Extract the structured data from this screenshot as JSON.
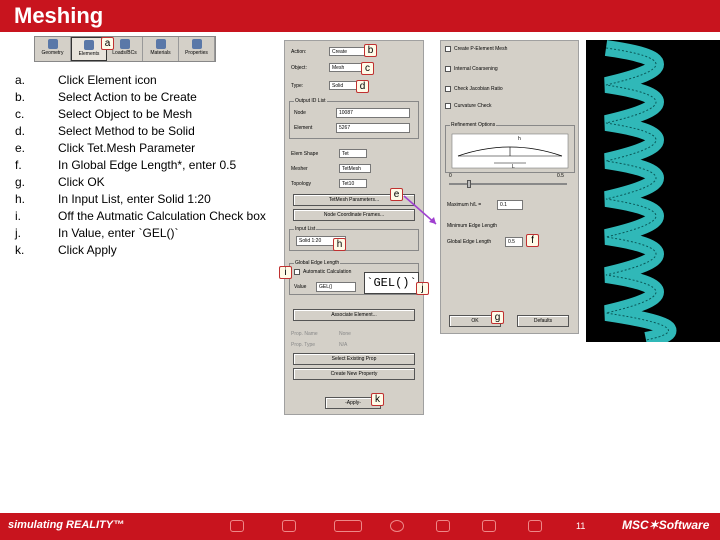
{
  "title": "Meshing",
  "toolbar": {
    "items": [
      {
        "label": "Geometry",
        "icon": "geometry-icon"
      },
      {
        "label": "Elements",
        "icon": "elements-icon"
      },
      {
        "label": "Loads/BCs",
        "icon": "loads-icon"
      },
      {
        "label": "Materials",
        "icon": "materials-icon"
      },
      {
        "label": "Properties",
        "icon": "properties-icon"
      }
    ]
  },
  "steps": [
    {
      "letter": "a.",
      "text": "Click Element icon"
    },
    {
      "letter": "b.",
      "text": "Select Action to be Create"
    },
    {
      "letter": "c.",
      "text": "Select Object to be Mesh"
    },
    {
      "letter": "d.",
      "text": "Select Method to be Solid"
    },
    {
      "letter": "e.",
      "text": "Click Tet.Mesh Parameter"
    },
    {
      "letter": "f.",
      "text": "In Global Edge Length*, enter 0.5"
    },
    {
      "letter": "g.",
      "text": "Click OK"
    },
    {
      "letter": "h.",
      "text": "In Input List, enter Solid 1:20"
    },
    {
      "letter": "i.",
      "text": "Off the Autmatic Calculation Check box"
    },
    {
      "letter": "j.",
      "text": "In Value, enter `GEL()`"
    },
    {
      "letter": "k.",
      "text": "Click Apply"
    }
  ],
  "callouts": {
    "a": "a",
    "b": "b",
    "c": "c",
    "d": "d",
    "e": "e",
    "f": "f",
    "g": "g",
    "h": "h",
    "i": "i",
    "j": "j",
    "k": "k"
  },
  "left_panel": {
    "action_label": "Action:",
    "action_value": "Create",
    "object_label": "Object:",
    "object_value": "Mesh",
    "type_label": "Type:",
    "type_value": "Solid",
    "output_ids": "Output ID List",
    "node_label": "Node",
    "node_value": "10087",
    "element_label": "Element",
    "element_value": "5267",
    "elem_shape_label": "Elem Shape",
    "elem_shape_value": "Tet",
    "mesher_label": "Mesher",
    "mesher_value": "TetMesh",
    "topology_label": "Topology",
    "topology_value": "Tet10",
    "tetmesh_btn": "TetMesh Parameters...",
    "node_coord_btn": "Node Coordinate Frames...",
    "input_list_label": "Input List",
    "input_list_value": "Solid 1:20",
    "global_edge": "Global Edge Length",
    "auto_calc": "Automatic Calculation",
    "value_label": "Value",
    "value_value": "GEL()",
    "gel_big": "`GEL()`",
    "assoc_btn": "Associate Element...",
    "prop_name": "Prop. Name",
    "prop_type": "Prop. Type",
    "prop_name_val": "None",
    "prop_type_val": "N/A",
    "select_prop_btn": "Select Existing Prop",
    "create_prop_btn": "Create New Property",
    "apply_btn": "-Apply-"
  },
  "right_panel": {
    "chk1": "Create P-Element Mesh",
    "chk2": "Internal Coarsening",
    "chk3": "Check Jacobian Ratio",
    "chk4": "Curvature Check",
    "refinement": "Refinement Options",
    "h_label": "h",
    "l_label": "L",
    "zero": "0",
    "max_val": "0.5",
    "max_hl_label": "Maximum h/L =",
    "max_hl_value": "0.1",
    "min_edge_label": "Minimum Edge Length",
    "ratio_label": "Global Edge Length",
    "ratio_value": "0.5",
    "ok_btn": "OK",
    "defaults_btn": "Defaults"
  },
  "footer": {
    "brand": "simulating REALITY™",
    "page": "11",
    "logo": "MSC✶Software"
  },
  "colors": {
    "brand_red": "#c8141e",
    "mesh_cyan": "#38d8d8",
    "arrow_purple": "#a040d0"
  }
}
